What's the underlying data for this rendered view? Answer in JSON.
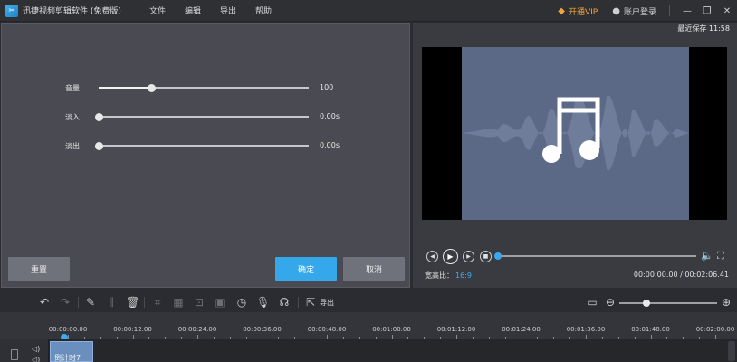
{
  "titlebar": {
    "app_title": "迅捷视频剪辑软件 (免费版)",
    "menu": [
      "文件",
      "编辑",
      "导出",
      "帮助"
    ],
    "vip_label": "开通VIP",
    "login_label": "账户登录",
    "window_buttons": [
      "minimize-icon",
      "restore-icon",
      "close-icon"
    ]
  },
  "audio_panel": {
    "sliders": [
      {
        "label": "音量",
        "value_text": "100",
        "fraction": 0.25
      },
      {
        "label": "淡入",
        "value_text": "0.00s",
        "fraction": 0.0
      },
      {
        "label": "淡出",
        "value_text": "0.00s",
        "fraction": 0.0
      }
    ],
    "reset_label": "重置",
    "ok_label": "确定",
    "cancel_label": "取消"
  },
  "preview": {
    "saved_label": "最近保存 11:58",
    "aspect_ratio_label": "宽高比：",
    "aspect_ratio_value": "16:9",
    "time_readout": "00:00:00.00 / 00:02:06.41",
    "progress_fraction": 0.0
  },
  "timeline": {
    "export_label": "导出",
    "zoom_fraction": 0.28,
    "ruler_ticks": [
      "00:00:00.00",
      "00:00:12.00",
      "00:00:24.00",
      "00:00:36.00",
      "00:00:48.00",
      "00:01:00.00",
      "00:01:12.00",
      "00:01:24.00",
      "00:01:36.00",
      "00:01:48.00",
      "00:02:00.00"
    ],
    "clip_label": "倒计时7"
  },
  "colors": {
    "accent": "#35a7eb",
    "vip": "#f2a53a",
    "panel": "#4a4b52",
    "video_bg": "#5b6987"
  }
}
